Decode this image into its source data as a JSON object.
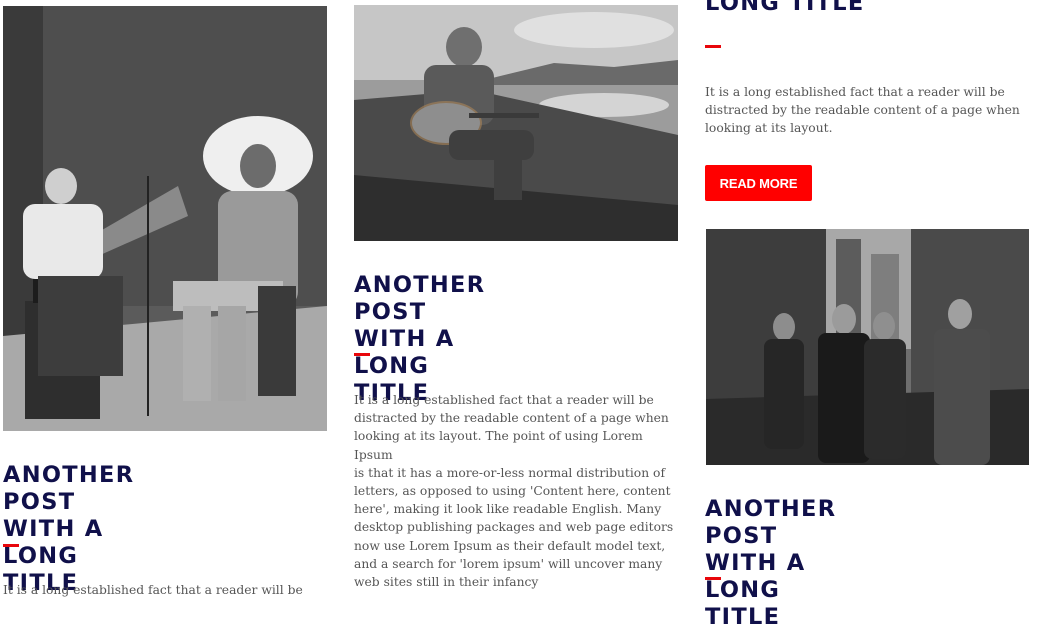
{
  "colors": {
    "title": "#10104a",
    "accent": "#e8060b",
    "button": "#ff0000",
    "body_text": "#555555"
  },
  "posts": [
    {
      "image": "black-and-white-photo-man-in-headdress-and-woman-with-phonograph",
      "title": "Another post with a\nlong title",
      "excerpt": "It is a long established fact that a reader will be"
    },
    {
      "image": "black-and-white-photo-man-playing-guitar-on-hillside",
      "title": "Another post with a\nlong title",
      "excerpt": "It is a long established fact that a reader will be\ndistracted by the readable content of a page when\nlooking at its layout. The point of using Lorem Ipsum\nis that it has a more-or-less normal distribution of\nletters, as opposed to using 'Content here, content\nhere', making it look like readable English. Many\ndesktop publishing packages and web page editors\nnow use Lorem Ipsum as their default model text,\nand a search for 'lorem ipsum' will uncover many\nweb sites still in their infancy"
    },
    {
      "title": "Long title",
      "excerpt": "It is a long established fact that a reader will be\ndistracted by the readable content of a page when\nlooking at its layout.",
      "button": "Read more"
    },
    {
      "image": "black-and-white-photo-four-men-in-street",
      "title": "Another post with a\nlong title"
    }
  ]
}
